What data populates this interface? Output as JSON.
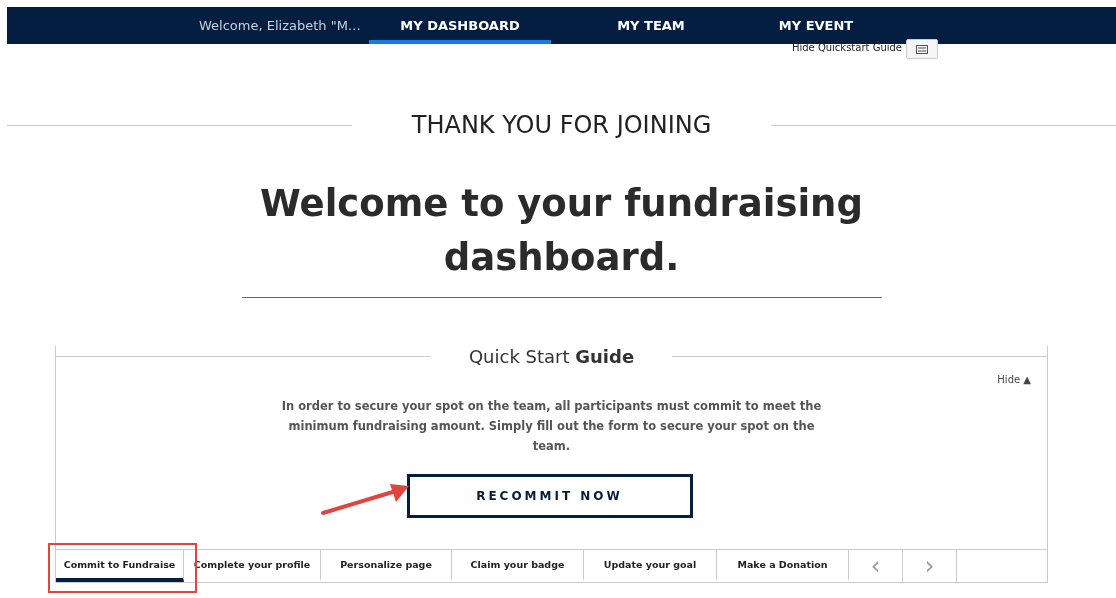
{
  "nav": {
    "welcome": "Welcome, Elizabeth \"M…",
    "items": [
      {
        "label": "MY DASHBOARD",
        "selected": true
      },
      {
        "label": "MY TEAM",
        "selected": false
      },
      {
        "label": "MY EVENT",
        "selected": false
      }
    ]
  },
  "hide_guide_link": "Hide Quickstart Guide",
  "kicker": "THANK YOU FOR JOINING",
  "heading": "Welcome to your fundraising dashboard.",
  "guide": {
    "title": "Quick Start **Guide**",
    "hide": "Hide ▲",
    "message": "In order to secure your spot on the team, all participants must commit to meet the minimum fundraising amount. Simply fill out the form to secure your spot on the team.",
    "button": "RECOMMIT NOW",
    "steps": [
      {
        "label": "Commit to Fundraise",
        "selected": true
      },
      {
        "label": "Complete your profile",
        "selected": false
      },
      {
        "label": "Personalize page",
        "selected": false
      },
      {
        "label": "Claim your badge",
        "selected": false
      },
      {
        "label": "Update your goal",
        "selected": false
      },
      {
        "label": "Make a Donation",
        "selected": false
      }
    ],
    "prev": "‹",
    "next": "›"
  }
}
